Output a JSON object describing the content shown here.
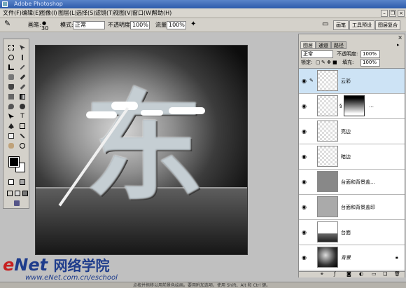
{
  "app": {
    "title": "Adobe Photoshop"
  },
  "menu": {
    "items": [
      "文件(F)",
      "编辑(E)",
      "图像(I)",
      "图层(L)",
      "选择(S)",
      "滤镜(T)",
      "视图(V)",
      "窗口(W)",
      "帮助(H)"
    ]
  },
  "options": {
    "brush_label": "画笔:",
    "brush_size": "30",
    "mode_label": "模式:",
    "mode_value": "正常",
    "opacity_label": "不透明度:",
    "opacity_value": "100%",
    "flow_label": "流量:",
    "flow_value": "100%",
    "dock_tabs": [
      "画笔",
      "工具预设",
      "图层复合"
    ]
  },
  "canvas": {
    "character": "东"
  },
  "layers_panel": {
    "tabs": [
      "图层",
      "通道",
      "路径"
    ],
    "blend_mode": "正常",
    "opacity_label": "不透明度:",
    "opacity_value": "100%",
    "lock_label": "锁定:",
    "fill_label": "填充:",
    "fill_value": "100%",
    "layers": [
      {
        "name": "云彩",
        "active": true
      },
      {
        "name": "",
        "has_mask": true
      },
      {
        "name": "亮边"
      },
      {
        "name": "暗边"
      },
      {
        "name": "台面和背景盖..."
      },
      {
        "name": "台面和背景盖印"
      },
      {
        "name": "台面"
      },
      {
        "name": "背景"
      }
    ]
  },
  "watermark": {
    "brand_e": "e",
    "brand_net": "Net",
    "brand_cn": "网络学院",
    "url": "www.eNet.com.cn/eschool"
  },
  "status": {
    "text": "点按并拖移以用前景色绘画。要用附加选项，使用 Shift、Alt 和 Ctrl 键。"
  }
}
